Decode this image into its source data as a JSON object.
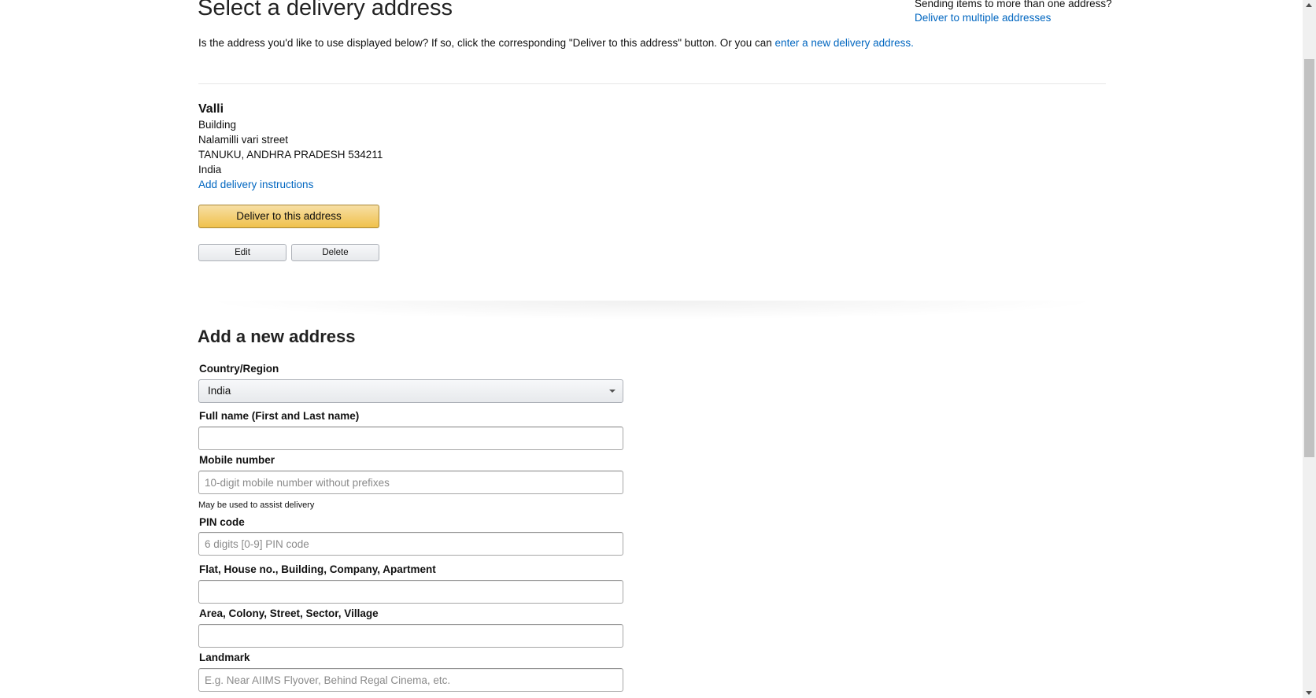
{
  "header": {
    "title": "Select a delivery address",
    "multi_question": "Sending items to more than one address?",
    "multi_link": "Deliver to multiple addresses"
  },
  "intro": {
    "text": "Is the address you'd like to use displayed below? If so, click the corresponding \"Deliver to this address\" button. Or you can ",
    "link": "enter a new delivery address."
  },
  "address": {
    "name": "Valli",
    "line1": "Building",
    "line2": "Nalamilli vari street",
    "line3": "TANUKU, ANDHRA PRADESH 534211",
    "country": "India",
    "instructions_link": "Add delivery instructions",
    "deliver_button": "Deliver to this address",
    "edit_button": "Edit",
    "delete_button": "Delete"
  },
  "form": {
    "title": "Add a new address",
    "country_label": "Country/Region",
    "country_value": "India",
    "fullname_label": "Full name (First and Last name)",
    "fullname_value": "",
    "mobile_label": "Mobile number",
    "mobile_placeholder": "10-digit mobile number without prefixes",
    "mobile_hint": "May be used to assist delivery",
    "pin_label": "PIN code",
    "pin_placeholder": "6 digits [0-9] PIN code",
    "flat_label": "Flat, House no., Building, Company, Apartment",
    "area_label": "Area, Colony, Street, Sector, Village",
    "landmark_label": "Landmark",
    "landmark_placeholder": "E.g. Near AIIMS Flyover, Behind Regal Cinema, etc."
  }
}
